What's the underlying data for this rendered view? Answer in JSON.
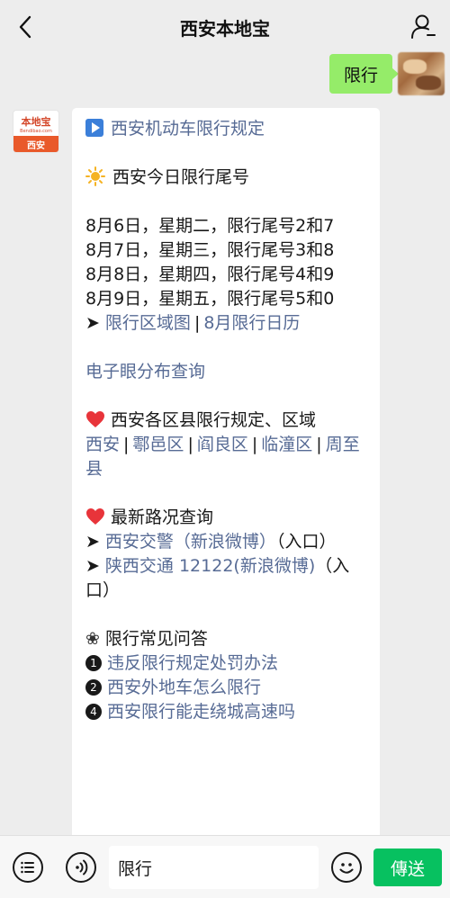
{
  "header": {
    "title": "西安本地宝",
    "back_icon": "chevron-left-icon",
    "profile_icon": "person-icon"
  },
  "user_message": {
    "text": "限行"
  },
  "bot_avatar": {
    "logo_text": "本地宝",
    "logo_url": "Bendibao.com",
    "logo_city": "西安"
  },
  "reply": {
    "rules_link": "西安机动车限行规定",
    "today_title": "西安今日限行尾号",
    "schedule": [
      "8月6日，星期二，限行尾号2和7",
      "8月7日，星期三，限行尾号3和8",
      "8月8日，星期四，限行尾号4和9",
      "8月9日，星期五，限行尾号5和0"
    ],
    "arrow_glyph": "➤",
    "zone_map_link": "限行区域图",
    "separator": "|",
    "calendar_link": "8月限行日历",
    "camera_link": "电子眼分布查询",
    "district_title": "西安各区县限行规定、区域",
    "district_links": [
      "西安",
      "鄠邑区",
      "阎良区",
      "临潼区",
      "周至县"
    ],
    "traffic_title": "最新路况查询",
    "traffic_items": [
      {
        "link": "西安交警（新浪微博）",
        "suffix": "（入口）"
      },
      {
        "link": "陕西交通 12122(新浪微博)",
        "suffix": "（入口）"
      }
    ],
    "faq_glyph": "❀",
    "faq_title": "限行常见问答",
    "faq_items": [
      {
        "num": "1",
        "text": "违反限行规定处罚办法"
      },
      {
        "num": "2",
        "text": "西安外地车怎么限行"
      },
      {
        "num": "4",
        "text": "西安限行能走绕城高速吗"
      }
    ]
  },
  "footer": {
    "input_value": "限行",
    "send_label": "傳送",
    "menu_icon": "menu-icon",
    "voice_icon": "voice-icon",
    "emoji_icon": "emoji-icon"
  },
  "colors": {
    "link": "#576b95",
    "user_bubble": "#95ec69",
    "send_button": "#07c160"
  }
}
